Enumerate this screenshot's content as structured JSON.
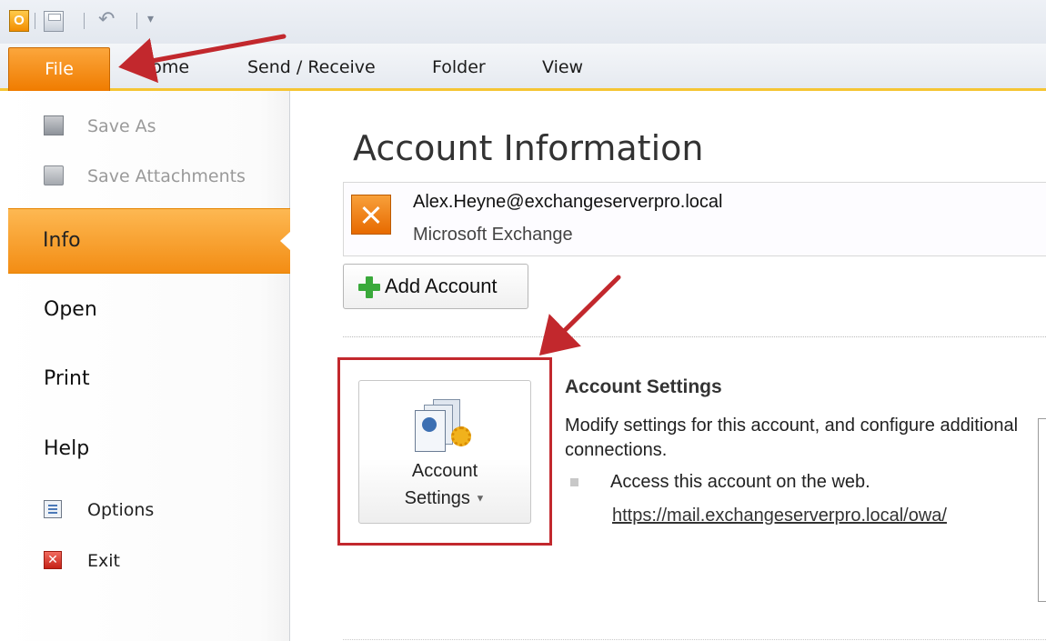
{
  "app": {
    "quick_access_logo": "O",
    "accent_color": "#f28d1a",
    "highlight_color": "#c2282d"
  },
  "ribbon": {
    "file_tab": "File",
    "tabs": [
      "Home",
      "Send / Receive",
      "Folder",
      "View"
    ]
  },
  "backstage_nav": {
    "save_as": "Save As",
    "save_attachments": "Save Attachments",
    "info": "Info",
    "open": "Open",
    "print": "Print",
    "help": "Help",
    "options": "Options",
    "exit": "Exit"
  },
  "main": {
    "title": "Account Information",
    "account": {
      "email": "Alex.Heyne@exchangeserverpro.local",
      "type": "Microsoft Exchange"
    },
    "add_account_label": "Add Account",
    "account_settings_button": {
      "line1": "Account",
      "line2": "Settings"
    },
    "account_settings_section": {
      "title": "Account Settings",
      "description": "Modify settings for this account, and configure additional connections.",
      "bullet": "Access this account on the web.",
      "link": "https://mail.exchangeserverpro.local/owa/"
    }
  },
  "icons": {
    "save_as": "save-as-icon",
    "save_attachments": "save-attachments-icon",
    "options": "options-icon",
    "exit": "exit-icon",
    "exchange": "exchange-icon",
    "add_account": "plus-icon",
    "account_settings": "account-settings-icon"
  }
}
